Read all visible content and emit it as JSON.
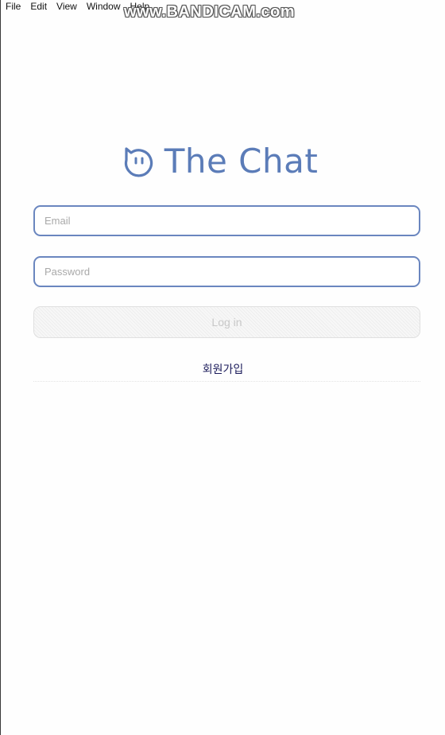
{
  "menubar": {
    "items": [
      "File",
      "Edit",
      "View",
      "Window",
      "Help"
    ]
  },
  "watermark": "www.BANDICAM.com",
  "brand": {
    "logo_icon": "smiley-chat-icon",
    "title": "The Chat",
    "color": "#5b7cb8"
  },
  "login_form": {
    "email_placeholder": "Email",
    "email_value": "",
    "password_placeholder": "Password",
    "password_value": "",
    "login_label": "Log in",
    "signup_label": "회원가입"
  },
  "colors": {
    "input_border": "#6a86bf",
    "button_disabled_text": "#c8c8c8"
  }
}
